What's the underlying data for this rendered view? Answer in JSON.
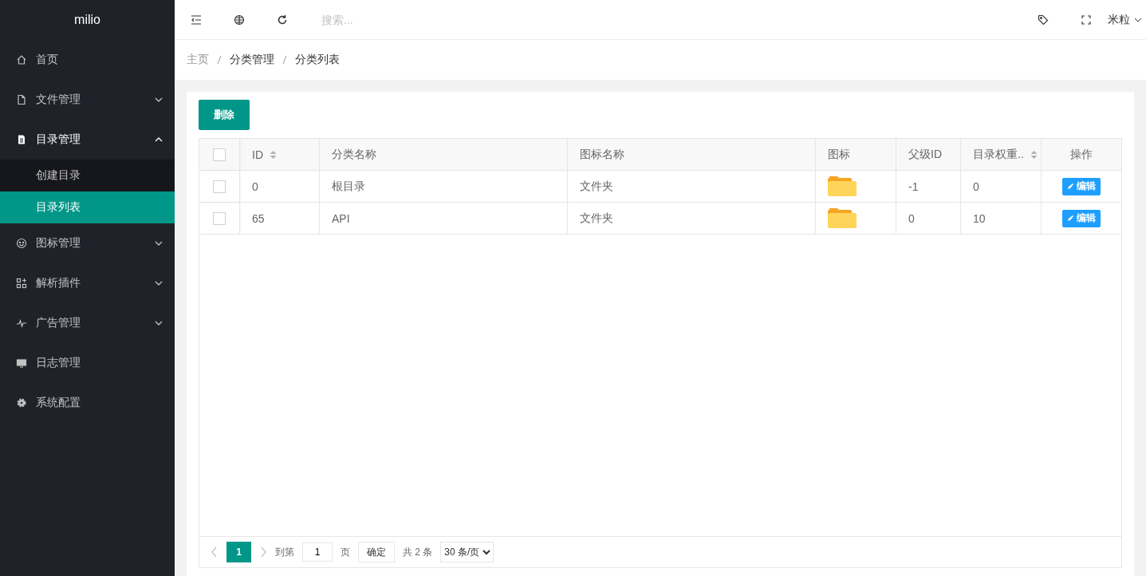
{
  "sidebar": {
    "logo": "milio",
    "items": [
      {
        "label": "首页"
      },
      {
        "label": "文件管理",
        "expanded": false
      },
      {
        "label": "目录管理",
        "expanded": true,
        "children": [
          {
            "label": "创建目录",
            "selected": false
          },
          {
            "label": "目录列表",
            "selected": true
          }
        ]
      },
      {
        "label": "图标管理",
        "expanded": false
      },
      {
        "label": "解析插件",
        "expanded": false
      },
      {
        "label": "广告管理",
        "expanded": false
      },
      {
        "label": "日志管理"
      },
      {
        "label": "系统配置"
      }
    ]
  },
  "header": {
    "search": {
      "placeholder": "搜索..."
    },
    "user": "米粒"
  },
  "breadcrumb": [
    "主页",
    "分类管理",
    "分类列表"
  ],
  "toolbar": {
    "delete_button": "删除"
  },
  "table": {
    "all_checked": false,
    "columns": [
      {
        "label": "ID",
        "sortable": true
      },
      {
        "label": "分类名称",
        "sortable": false
      },
      {
        "label": "图标名称",
        "sortable": false
      },
      {
        "label": "图标",
        "sortable": false
      },
      {
        "label": "父级ID",
        "sortable": false
      },
      {
        "label": "目录权重..",
        "sortable": true
      },
      {
        "label": "操作",
        "sortable": false
      }
    ],
    "rows": [
      {
        "checked": false,
        "cells": [
          "0",
          "根目录",
          "文件夹"
        ],
        "kind": "folder",
        "parent_id": "-1",
        "weight": "0",
        "action": "编辑"
      },
      {
        "checked": false,
        "cells": [
          "65",
          "API",
          "文件夹"
        ],
        "kind": "folder",
        "parent_id": "0",
        "weight": "10",
        "action": "编辑"
      }
    ]
  },
  "pagination": {
    "pages": [
      {
        "label": "1",
        "selected": true
      }
    ],
    "goto_label": "到第",
    "goto_value": "1",
    "page_unit": "页",
    "confirm": "确定",
    "total": "共 2 条",
    "page_size": "30 条/页"
  }
}
